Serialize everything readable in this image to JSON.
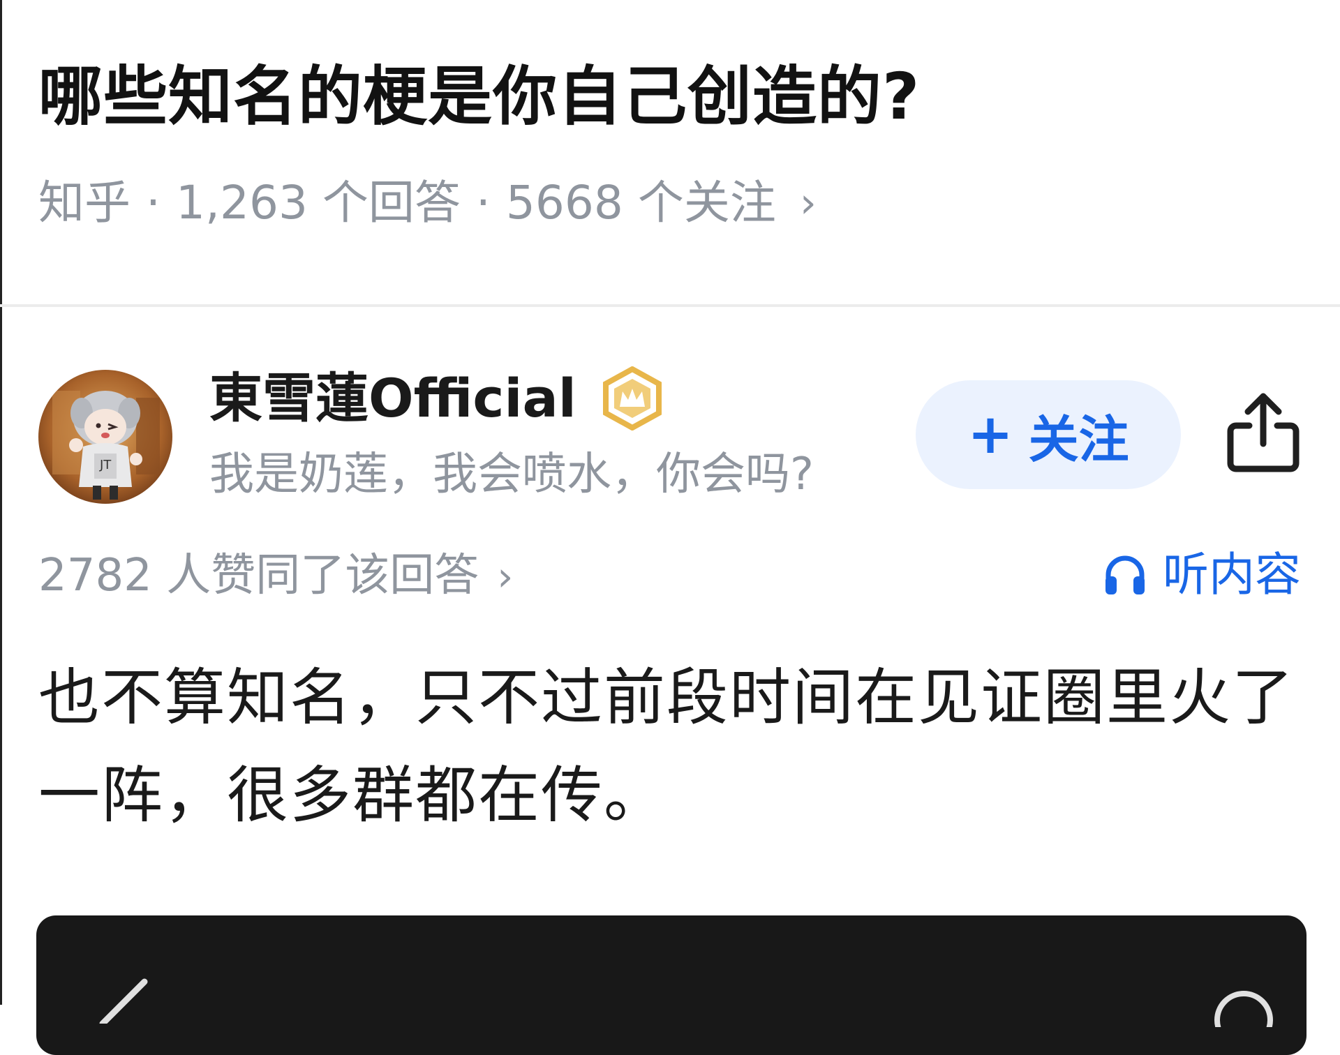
{
  "question": {
    "title": "哪些知名的梗是你自己创造的?",
    "source": "知乎",
    "answer_count": "1,263 个回答",
    "follow_count": "5668 个关注",
    "separator": "·",
    "chevron": "›"
  },
  "author": {
    "name": "東雪蓮Official",
    "bio": "我是奶莲，我会喷水，你会吗?",
    "badge_icon": "crown-badge-icon",
    "follow_label": "关注",
    "follow_plus": "+"
  },
  "answer": {
    "vote_text": "2782 人赞同了该回答",
    "vote_chevron": "›",
    "listen_label": "听内容",
    "body": "也不算知名，只不过前段时间在见证圈里火了一阵，很多群都在传。"
  },
  "colors": {
    "accent": "#1966e6",
    "follow_bg": "#ebf2fe",
    "meta_gray": "#8f959e",
    "card_dark": "#181818",
    "badge_gold": "#e8b64a"
  }
}
